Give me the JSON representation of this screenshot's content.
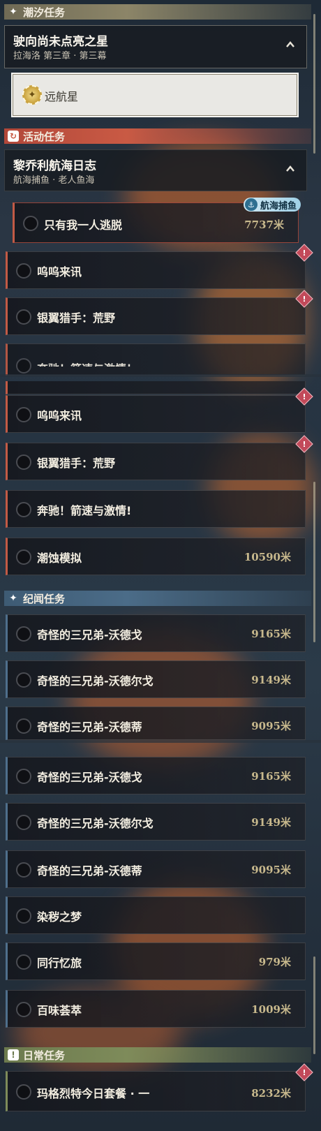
{
  "sections": {
    "tidal": {
      "title": "潮汐任务",
      "icon": "sparkle-icon"
    },
    "event": {
      "title": "活动任务",
      "icon": "refresh-icon"
    },
    "story": {
      "title": "纪闻任务",
      "icon": "sparkle-icon"
    },
    "daily": {
      "title": "日常任务",
      "icon": "exclamation-icon"
    }
  },
  "tidal_chapter": {
    "title": "驶向尚未点亮之星",
    "subtitle": "拉海洛 第三章 · 第三幕"
  },
  "pinned_task": {
    "label": "远航星"
  },
  "event_chapter": {
    "title": "黎乔利航海日志",
    "subtitle": "航海捕鱼 · 老人鱼海"
  },
  "event_tasks": [
    {
      "label": "只有我一人逃脱",
      "distance": "7737米",
      "tag": "航海捕鱼"
    },
    {
      "label": "呜呜来讯"
    },
    {
      "label": "银翼猎手：荒野"
    },
    {
      "label": "奔驰！箭速与激情！"
    },
    {
      "label": "呜呜来讯"
    },
    {
      "label": "银翼猎手：荒野"
    },
    {
      "label": "奔驰！箭速与激情!"
    },
    {
      "label": "潮蚀模拟",
      "distance": "10590米"
    }
  ],
  "story_tasks": [
    {
      "label": "奇怪的三兄弟-沃德戈",
      "distance": "9165米"
    },
    {
      "label": "奇怪的三兄弟-沃德尔戈",
      "distance": "9149米"
    },
    {
      "label": "奇怪的三兄弟-沃德蒂",
      "distance": "9095米"
    },
    {
      "label": "奇怪的三兄弟-沃德戈",
      "distance": "9165米"
    },
    {
      "label": "奇怪的三兄弟-沃德尔戈",
      "distance": "9149米"
    },
    {
      "label": "奇怪的三兄弟-沃德蒂",
      "distance": "9095米"
    },
    {
      "label": "染秽之梦"
    },
    {
      "label": "同行忆旅",
      "distance": "979米"
    },
    {
      "label": "百味荟萃",
      "distance": "1009米"
    }
  ],
  "daily_tasks": [
    {
      "label": "玛格烈特今日套餐 · 一",
      "distance": "8232米"
    }
  ],
  "alert_badge": "!",
  "colors": {
    "accent_event": "#c25a45",
    "accent_story": "#4f6f8c",
    "accent_tidal": "#8e8666",
    "accent_daily": "#7e8b5a",
    "distance": "#c8b98d"
  }
}
